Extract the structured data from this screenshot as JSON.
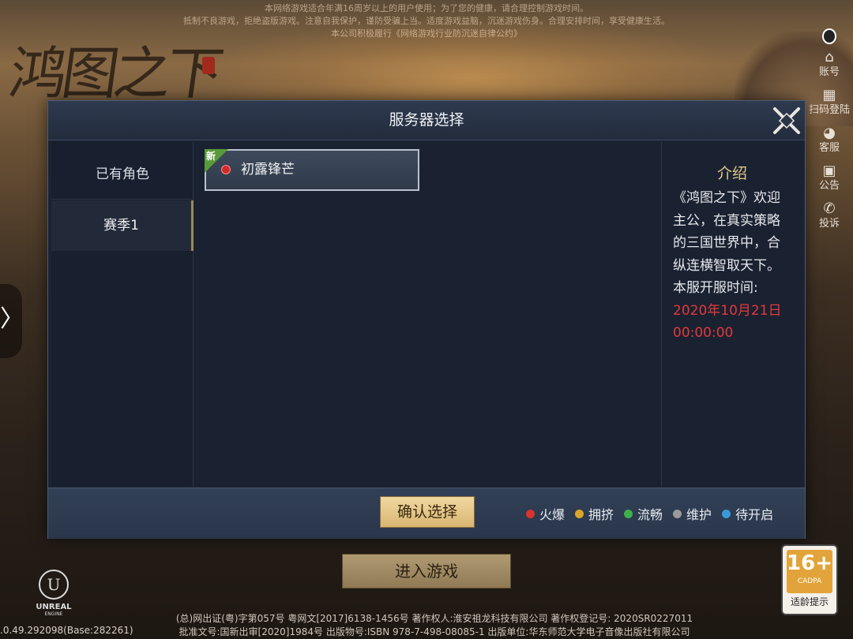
{
  "notice": {
    "lines": [
      "本网络游戏适合年满16周岁以上的用户使用；为了您的健康，请合理控制游戏时间。",
      "抵制不良游戏，拒绝盗版游戏。注意自我保护，谨防受骗上当。适度游戏益脑，沉迷游戏伤身。合理安排时间，享受健康生活。",
      "本公司积极履行《网络游戏行业防沉迷自律公约》"
    ]
  },
  "logo": {
    "text": "鸿图之下"
  },
  "rail": {
    "items": [
      {
        "icon": "account-icon",
        "label": "账号"
      },
      {
        "icon": "qr-code-icon",
        "label": "扫码登陆"
      },
      {
        "icon": "customer-service-icon",
        "label": "客服"
      },
      {
        "icon": "announcement-icon",
        "label": "公告"
      },
      {
        "icon": "complaint-icon",
        "label": "投诉"
      }
    ]
  },
  "side_handle": {
    "glyph": "〉"
  },
  "dialog": {
    "title": "服务器选择",
    "tabs": [
      {
        "label": "已有角色"
      },
      {
        "label": "赛季1"
      }
    ],
    "servers": [
      {
        "tag": "新",
        "name": "初露锋芒",
        "status_color": "#d32a2a"
      }
    ],
    "intro": {
      "title": "介绍",
      "body": "《鸿图之下》欢迎主公，在真实策略的三国世界中，合纵连横智取天下。",
      "open_label": "本服开服时间:",
      "open_time": "2020年10月21日 00:00:00"
    },
    "confirm_label": "确认选择",
    "legend": [
      {
        "label": "火爆",
        "color": "#d8342c"
      },
      {
        "label": "拥挤",
        "color": "#d9a62a"
      },
      {
        "label": "流畅",
        "color": "#3fb04a"
      },
      {
        "label": "维护",
        "color": "#9a9a9a"
      },
      {
        "label": "待开启",
        "color": "#3a9ad9"
      }
    ]
  },
  "enter_label": "进入游戏",
  "engine": {
    "name": "UNREAL",
    "sub": "ENGINE"
  },
  "version": ".0.49.292098(Base:282261)",
  "footer": {
    "line1": "(总)网出证(粤)字第057号 粤网文[2017]6138-1456号  著作权人:淮安祖龙科技有限公司  著作权登记号: 2020SR0227011",
    "line2": "批准文号:国新出审[2020]1984号    出版物号:ISBN 978-7-498-08085-1    出版单位:华东师范大学电子音像出版社有限公司"
  },
  "age_rating": {
    "number": "16+",
    "org": "CADPA",
    "caption": "适龄提示"
  }
}
